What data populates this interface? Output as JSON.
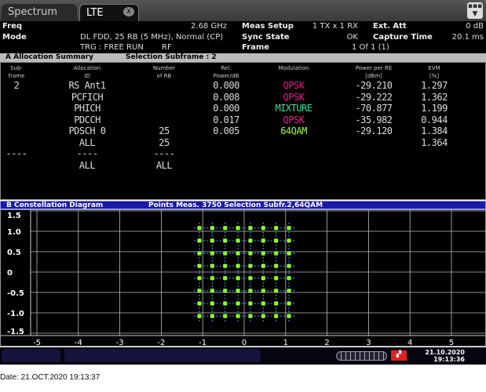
{
  "tabs": [
    {
      "label": "Spectrum"
    },
    {
      "label": "LTE"
    }
  ],
  "header": {
    "freq_label": "Freq",
    "freq": "2.68 GHz",
    "mode_label": "Mode",
    "mode": "DL FDD, 25 RB (5 MHz), Normal (CP)",
    "trg": "TRG   : FREE RUN",
    "rf": "RF",
    "meas_setup_label": "Meas Setup",
    "meas_setup": "1 TX x 1 RX",
    "sync_label": "Sync State",
    "sync": "OK",
    "frame_label": "Frame",
    "frame": "1 Of 1  (1)",
    "ext_att_label": "Ext. Att",
    "ext_att": "0 dB",
    "capture_label": "Capture Time",
    "capture": "20.1 ms"
  },
  "sectionA": {
    "title": "A  Allocation Summary",
    "selection": "Selection  Subframe : 2"
  },
  "table": {
    "headers": [
      [
        "Sub-",
        "frame"
      ],
      [
        "Allocation",
        "ID"
      ],
      [
        "Number",
        "of RB"
      ],
      [
        "Rel.",
        "Power/dB"
      ],
      [
        "Modulation",
        ""
      ],
      [
        "Power per RE",
        "[dBm]"
      ],
      [
        "EVM",
        "[%]"
      ]
    ],
    "rows": [
      [
        "2",
        "RS Ant1",
        "",
        "0.000",
        "QPSK",
        "-29.210",
        "1.297"
      ],
      [
        "",
        "PCFICH",
        "",
        "0.008",
        "QPSK",
        "-29.222",
        "1.362"
      ],
      [
        "",
        "PHICH",
        "",
        "0.000",
        "MIXTURE",
        "-70.877",
        "1.199"
      ],
      [
        "",
        "PDCCH",
        "",
        "0.017",
        "QPSK",
        "-35.982",
        "0.944"
      ],
      [
        "",
        "PDSCH 0",
        "25",
        "0.005",
        "64QAM",
        "-29.120",
        "1.384"
      ],
      [
        "",
        "ALL",
        "25",
        "",
        "",
        "",
        "1.364"
      ],
      [
        "----",
        "----",
        "----",
        "",
        "",
        "",
        ""
      ],
      [
        "",
        "ALL",
        "ALL",
        "",
        "",
        "",
        ""
      ]
    ],
    "mod_colors": {
      "QPSK": "#e0208c",
      "MIXTURE": "#30e0a0",
      "64QAM": "#a0ff30"
    }
  },
  "sectionB": {
    "title": "B  Constellation Diagram",
    "points": "Points Meas. 3750  Selection  Subfr.2,64QAM"
  },
  "chart_data": {
    "type": "scatter",
    "title": "Constellation Diagram",
    "modulation": "64QAM",
    "points_measured": 3750,
    "levels": [
      -1.08,
      -0.77,
      -0.46,
      -0.15,
      0.15,
      0.46,
      0.77,
      1.08
    ],
    "xlim": [
      -5.5,
      5.5
    ],
    "ylim": [
      -1.6,
      1.6
    ],
    "xticks": [
      "-5",
      "-4",
      "-3",
      "-2",
      "-1",
      "0",
      "1",
      "2",
      "3",
      "4",
      "5"
    ],
    "yticks": [
      "1.5",
      "1.0",
      "0.5",
      "0",
      "-0.5",
      "-1.0",
      "-1.5"
    ],
    "grid": true,
    "point_color": "#90ff20"
  },
  "status": {
    "date": "21.10.2020",
    "time": "19:13:36"
  },
  "footer": {
    "date": "Date: 21.OCT.2020  19:13:37"
  }
}
